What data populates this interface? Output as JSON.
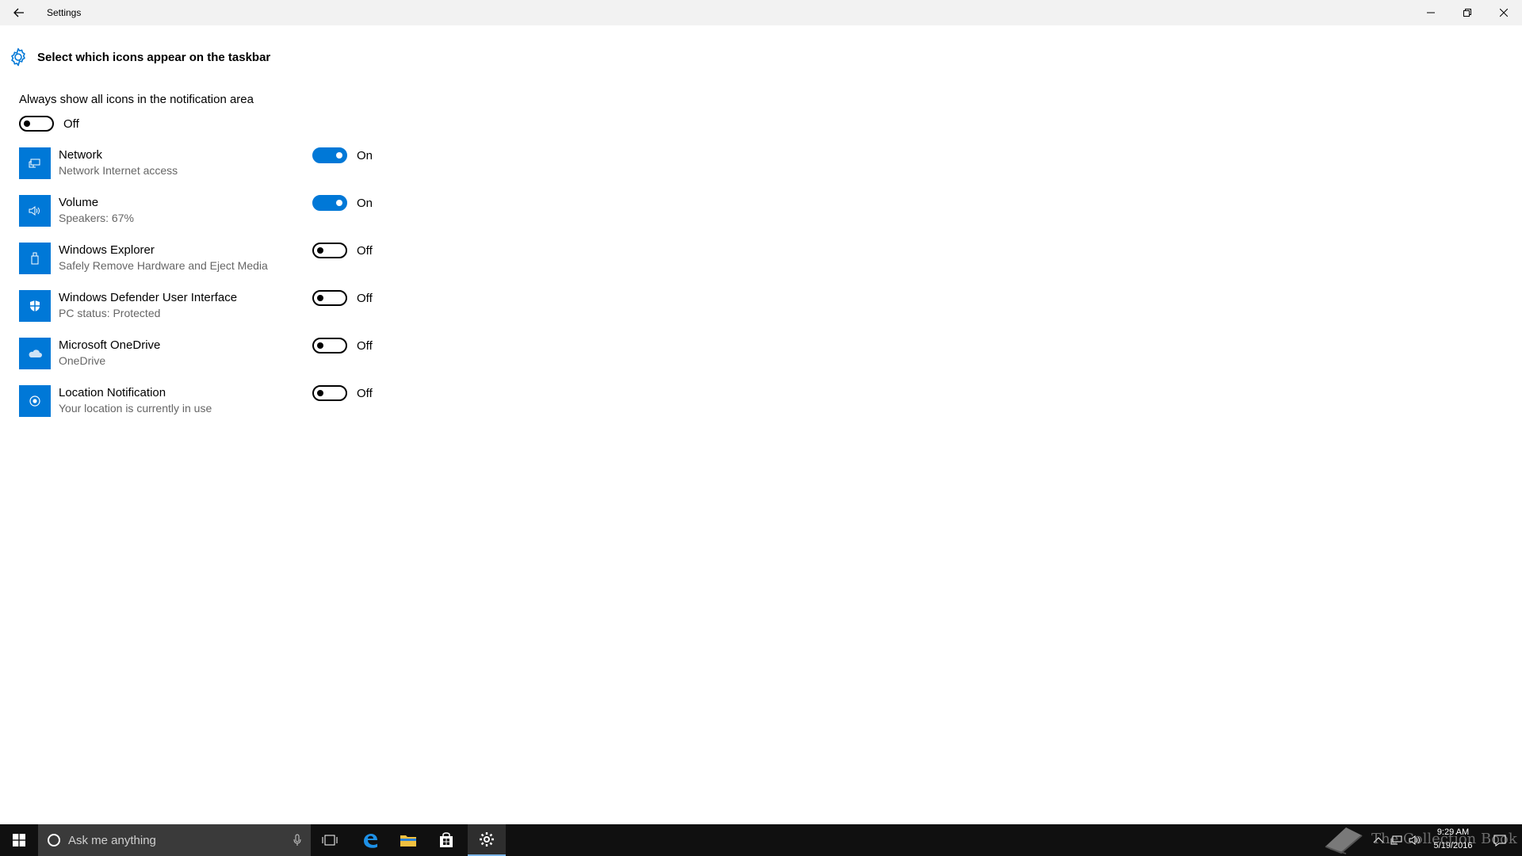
{
  "window": {
    "title": "Settings"
  },
  "page": {
    "heading": "Select which icons appear on the taskbar",
    "always_show": {
      "label": "Always show all icons in the notification area",
      "state": "Off"
    }
  },
  "items": [
    {
      "name": "Network",
      "description": "Network Internet access",
      "state": "On",
      "icon": "network-icon"
    },
    {
      "name": "Volume",
      "description": "Speakers: 67%",
      "state": "On",
      "icon": "volume-icon"
    },
    {
      "name": "Windows Explorer",
      "description": "Safely Remove Hardware and Eject Media",
      "state": "Off",
      "icon": "usb-drive-icon"
    },
    {
      "name": "Windows Defender User Interface",
      "description": "PC status: Protected",
      "state": "Off",
      "icon": "shield-icon"
    },
    {
      "name": "Microsoft OneDrive",
      "description": "OneDrive",
      "state": "Off",
      "icon": "cloud-icon"
    },
    {
      "name": "Location Notification",
      "description": "Your location is currently in use",
      "state": "Off",
      "icon": "location-icon"
    }
  ],
  "taskbar": {
    "search_placeholder": "Ask me anything",
    "clock_time": "9:29 AM",
    "clock_date": "5/19/2016"
  },
  "watermark": {
    "text": "The Collection Book"
  },
  "colors": {
    "accent": "#0078d7",
    "titlebar": "#f2f2f2",
    "taskbar": "#101010",
    "secondary_text": "#666666"
  }
}
